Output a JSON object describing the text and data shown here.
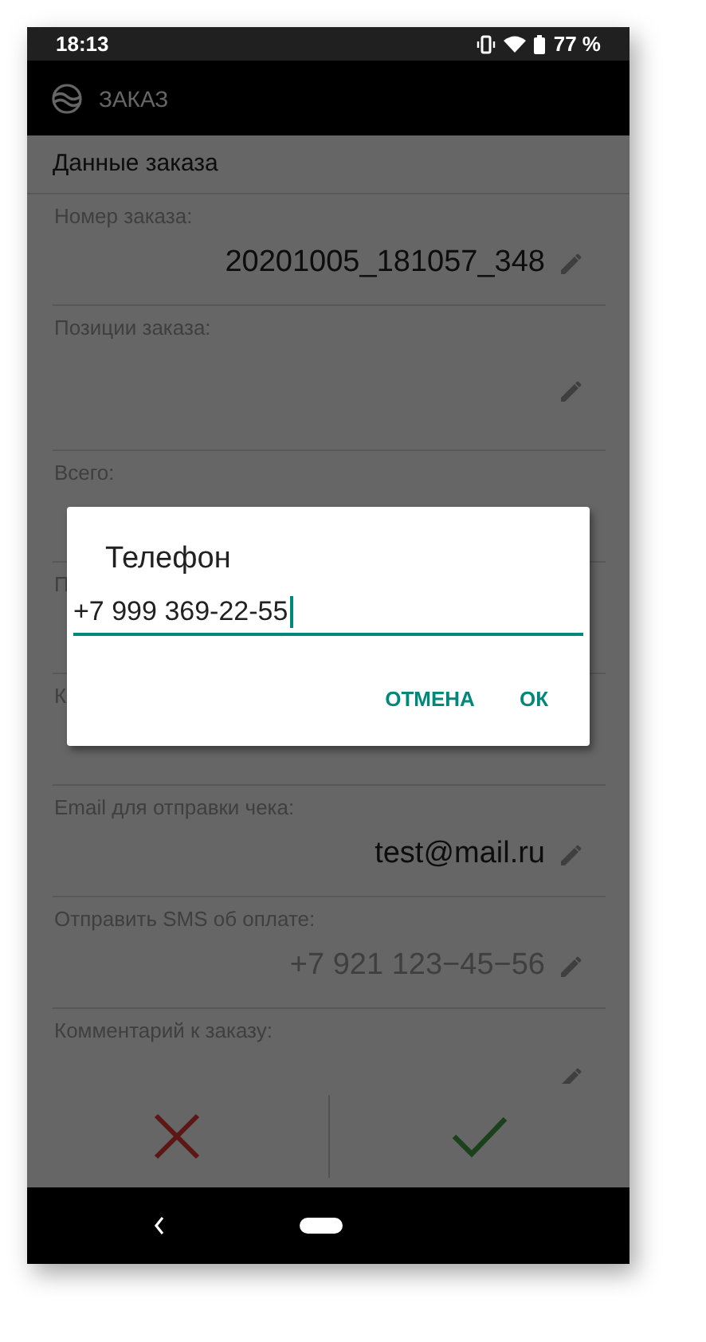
{
  "status_bar": {
    "time": "18:13",
    "battery": "77 %"
  },
  "app_bar": {
    "title": "ЗАКАЗ"
  },
  "section_title": "Данные заказа",
  "fields": [
    {
      "kind": "single",
      "label": "Номер заказа:",
      "value": "20201005_181057_348",
      "editable": true
    },
    {
      "kind": "list",
      "label": "Позиции заказа:",
      "editable": true
    },
    {
      "kind": "single",
      "label": "Всего:",
      "editable": false
    },
    {
      "kind": "single",
      "label": "П",
      "editable": false
    },
    {
      "kind": "single",
      "label": "К",
      "editable": false
    },
    {
      "kind": "single",
      "label": "Email для отправки чека:",
      "value": "test@mail.ru",
      "editable": true
    },
    {
      "kind": "single",
      "label": "Отправить SMS об оплате:",
      "placeholder": "+7 921 123−45−56",
      "editable": true
    },
    {
      "kind": "single",
      "label": "Комментарий к заказу:",
      "editable": true
    }
  ],
  "dialog": {
    "title": "Телефон",
    "value": "+7 999 369-22-55",
    "buttons": [
      {
        "label": "ОТМЕНА"
      },
      {
        "label": "ОК"
      }
    ]
  }
}
